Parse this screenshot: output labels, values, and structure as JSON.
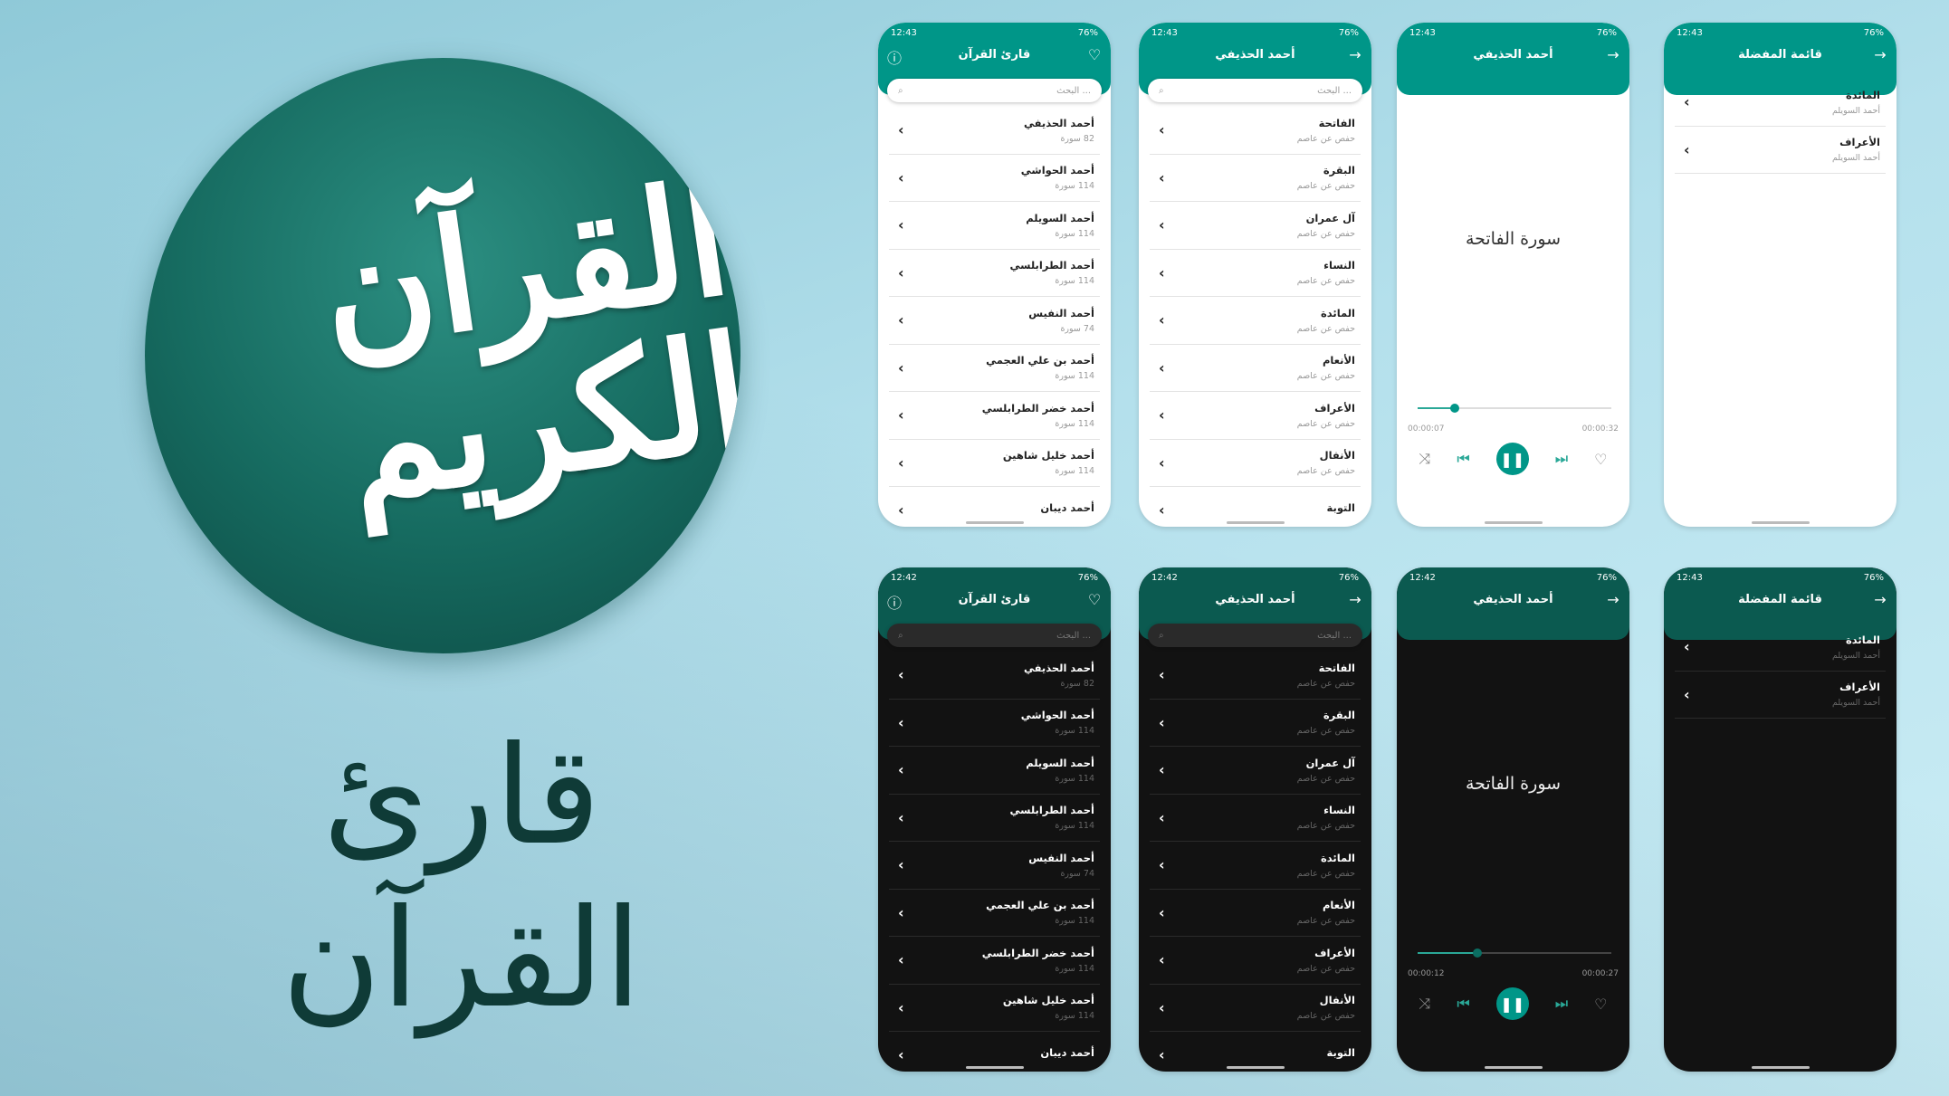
{
  "brand": {
    "logo_text": "القرآن الكريم",
    "app_title": "قارئ القرآن",
    "primary": "#009688",
    "dark_primary": "#0b5a50",
    "dark_bg": "#121212"
  },
  "search_placeholder": "البحث ...",
  "status_battery": "76%",
  "reciters": [
    {
      "name": "أحمد الحذيفي",
      "count": "82 سورة"
    },
    {
      "name": "أحمد الحواشي",
      "count": "114 سورة"
    },
    {
      "name": "أحمد السويلم",
      "count": "114 سورة"
    },
    {
      "name": "أحمد الطرابلسي",
      "count": "114 سورة"
    },
    {
      "name": "أحمد النفيس",
      "count": "74 سورة"
    },
    {
      "name": "أحمد بن علي العجمي",
      "count": "114 سورة"
    },
    {
      "name": "أحمد خضر الطرابلسي",
      "count": "114 سورة"
    },
    {
      "name": "أحمد خليل شاهين",
      "count": "114 سورة"
    },
    {
      "name": "أحمد ديبان",
      "count": ""
    }
  ],
  "surahs": [
    {
      "name": "الفاتحة",
      "riwaya": "حفص عن عاصم"
    },
    {
      "name": "البقرة",
      "riwaya": "حفص عن عاصم"
    },
    {
      "name": "آل عمران",
      "riwaya": "حفص عن عاصم"
    },
    {
      "name": "النساء",
      "riwaya": "حفص عن عاصم"
    },
    {
      "name": "المائدة",
      "riwaya": "حفص عن عاصم"
    },
    {
      "name": "الأنعام",
      "riwaya": "حفص عن عاصم"
    },
    {
      "name": "الأعراف",
      "riwaya": "حفص عن عاصم"
    },
    {
      "name": "الأنفال",
      "riwaya": "حفص عن عاصم"
    },
    {
      "name": "التوبة",
      "riwaya": ""
    }
  ],
  "favorites": [
    {
      "name": "المائدة",
      "reciter": "أحمد السويلم"
    },
    {
      "name": "الأعراف",
      "reciter": "أحمد السويلم"
    }
  ],
  "titles": {
    "home": "قارئ القرآن",
    "reciter": "أحمد الحذيفي",
    "favorites": "قائمة المفضلة"
  },
  "player_surah": "سورة الفاتحة",
  "phones": [
    {
      "type": "home",
      "theme": "light",
      "time": "12:43"
    },
    {
      "type": "reciter",
      "theme": "light",
      "time": "12:43"
    },
    {
      "type": "player",
      "theme": "light",
      "time": "12:43",
      "elapsed": "00:00:07",
      "total": "00:00:32",
      "progress": 0.19
    },
    {
      "type": "favorites",
      "theme": "light",
      "time": "12:43"
    },
    {
      "type": "home",
      "theme": "dark",
      "time": "12:42"
    },
    {
      "type": "reciter",
      "theme": "dark",
      "time": "12:42"
    },
    {
      "type": "player",
      "theme": "dark",
      "time": "12:42",
      "elapsed": "00:00:12",
      "total": "00:00:27",
      "progress": 0.31
    },
    {
      "type": "favorites",
      "theme": "dark",
      "time": "12:43"
    }
  ]
}
